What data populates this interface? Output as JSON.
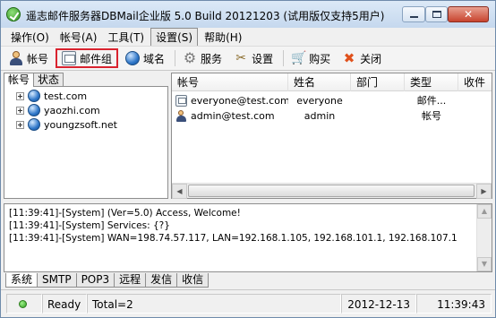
{
  "window": {
    "title": "遥志邮件服务器DBMail企业版 5.0 Build 20121203 (试用版仅支持5用户)",
    "close_glyph": "✕"
  },
  "menu": [
    {
      "label": "操作(O)"
    },
    {
      "label": "帐号(A)"
    },
    {
      "label": "工具(T)"
    },
    {
      "label": "设置(S)",
      "active": true
    },
    {
      "label": "帮助(H)"
    }
  ],
  "toolbar": {
    "account": "帐号",
    "mailgroup": "邮件组",
    "domain": "域名",
    "service": "服务",
    "settings": "设置",
    "buy": "购买",
    "close": "关闭",
    "highlight_color": "#d9232f"
  },
  "left_tabs": [
    {
      "label": "帐号",
      "active": true
    },
    {
      "label": "状态",
      "active": false
    }
  ],
  "domains": [
    {
      "label": "test.com"
    },
    {
      "label": "yaozhi.com"
    },
    {
      "label": "youngzsoft.net"
    }
  ],
  "list": {
    "columns": [
      "帐号",
      "姓名",
      "部门",
      "类型",
      "收件"
    ],
    "rows": [
      {
        "icon": "group-icon",
        "account": "everyone@test.com",
        "name": "everyone",
        "dept": "",
        "type": "邮件..."
      },
      {
        "icon": "user-icon",
        "account": "admin@test.com",
        "name": "admin",
        "dept": "",
        "type": "帐号"
      }
    ]
  },
  "log": [
    "[11:39:41]-[System] (Ver=5.0) Access, Welcome!",
    "[11:39:41]-[System] Services: {?}",
    "[11:39:41]-[System] WAN=198.74.57.117, LAN=192.168.1.105, 192.168.101.1, 192.168.107.1"
  ],
  "bottom_tabs": [
    {
      "label": "系统",
      "active": true
    },
    {
      "label": "SMTP",
      "active": false
    },
    {
      "label": "POP3",
      "active": false
    },
    {
      "label": "远程",
      "active": false
    },
    {
      "label": "发信",
      "active": false
    },
    {
      "label": "收信",
      "active": false
    }
  ],
  "status": {
    "ready": "Ready",
    "total": "Total=2",
    "date": "2012-12-13",
    "time": "11:39:43"
  }
}
